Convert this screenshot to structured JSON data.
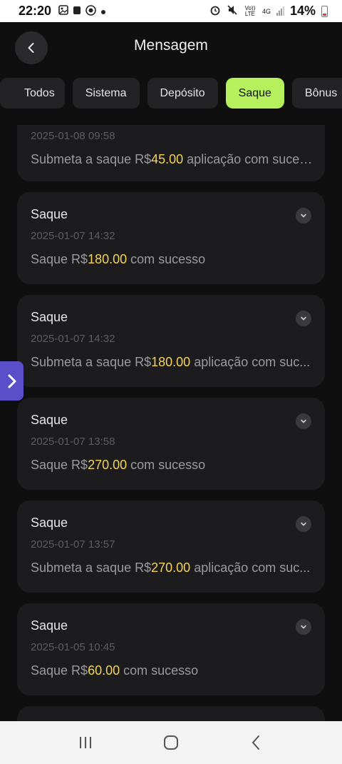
{
  "status_bar": {
    "time": "22:20",
    "left_icons": [
      "gallery-icon",
      "lock-icon",
      "shield-icon",
      "dot-icon"
    ],
    "right_icons": [
      "alarm-icon",
      "mute-icon",
      "volte-icon",
      "4g-icon",
      "signal-icon"
    ],
    "volte_label": "Vo)) LTE",
    "network_label": "4G",
    "battery_percent": "14%"
  },
  "header": {
    "title": "Mensagem"
  },
  "tabs": [
    {
      "label": "Todos",
      "active": false
    },
    {
      "label": "Sistema",
      "active": false
    },
    {
      "label": "Depósito",
      "active": false
    },
    {
      "label": "Saque",
      "active": true
    },
    {
      "label": "Bônus",
      "active": false
    }
  ],
  "messages": [
    {
      "title": "",
      "date": "2025-01-08 09:58",
      "prefix": "Submeta a saque R$",
      "amount": "45.00",
      "suffix": " aplicação com suces..."
    },
    {
      "title": "Saque",
      "date": "2025-01-07 14:32",
      "prefix": "Saque R$",
      "amount": "180.00",
      "suffix": " com sucesso"
    },
    {
      "title": "Saque",
      "date": "2025-01-07 14:32",
      "prefix": "Submeta a saque R$",
      "amount": "180.00",
      "suffix": " aplicação com suc..."
    },
    {
      "title": "Saque",
      "date": "2025-01-07 13:58",
      "prefix": "Saque R$",
      "amount": "270.00",
      "suffix": " com sucesso"
    },
    {
      "title": "Saque",
      "date": "2025-01-07 13:57",
      "prefix": "Submeta a saque R$",
      "amount": "270.00",
      "suffix": " aplicação com suc..."
    },
    {
      "title": "Saque",
      "date": "2025-01-05 10:45",
      "prefix": "Saque R$",
      "amount": "60.00",
      "suffix": " com sucesso"
    }
  ],
  "colors": {
    "background": "#0f0f10",
    "card": "#1c1c1e",
    "accent_tab": "#b6f05c",
    "amount": "#f3d35a",
    "side_handle": "#5b4fc9"
  },
  "nav_bar": {
    "buttons": [
      "recents-icon",
      "home-icon",
      "back-icon"
    ]
  }
}
